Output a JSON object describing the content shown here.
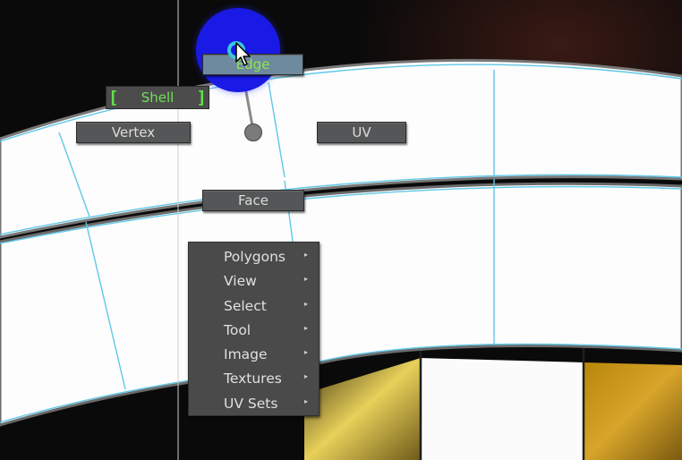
{
  "marking_menu": {
    "north": "Edge",
    "north_west": "Shell",
    "west": "Vertex",
    "east": "UV",
    "south": "Face"
  },
  "context_menu": {
    "items": [
      {
        "label": "Polygons",
        "has_submenu": true
      },
      {
        "label": "View",
        "has_submenu": true
      },
      {
        "label": "Select",
        "has_submenu": true
      },
      {
        "label": "Tool",
        "has_submenu": true
      },
      {
        "label": "Image",
        "has_submenu": true
      },
      {
        "label": "Textures",
        "has_submenu": true
      },
      {
        "label": "UV Sets",
        "has_submenu": true
      }
    ],
    "submenu_glyph": "▸"
  },
  "icons": {
    "highlight": "selection-highlight-icon",
    "cursor": "arrow-cursor-icon",
    "submenu": "submenu-arrow-icon"
  },
  "colors": {
    "uv_shell_fill": "#fdfdfd",
    "uv_edge": "#5fc8e8",
    "highlight_blue": "#1a1ae6",
    "active_label_green": "#6fe15a",
    "menu_background": "#4a4a4a"
  }
}
